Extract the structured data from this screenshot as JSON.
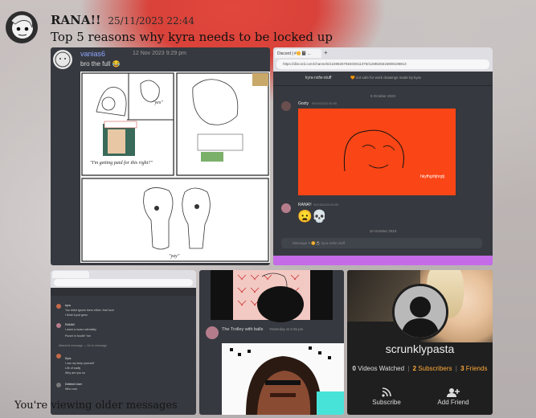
{
  "message": {
    "username": "RANA!!",
    "timestamp": "25/11/2023 22:44",
    "text": "Top 5 reasons why kyra needs to be locked up"
  },
  "attachments": {
    "drawing": {
      "author": "vanias6",
      "time": "12 Nov 2023 9:29 pm",
      "text": "bro the full",
      "captions": [
        "\"yes\"",
        "\"I'm getting paid for this right?\"",
        "\"yay\""
      ]
    },
    "discord_orange": {
      "tab_title": "Discord | #🌼📓 ...",
      "url": "https://discord.com/channels/1169826758403011376/1169825515808198813",
      "channel": "kyra-nsfw-stuff",
      "topic": "🧡 not safe for work drawings made by kyra",
      "date_top": "9 October 2023",
      "msg1_author": "Gozty",
      "msg1_time": "09/10/2023 00:00",
      "image_label": "hkyfhgrhjhrgtj",
      "msg2_author": "RANA!!",
      "msg2_time": "09/10/2023 00:00",
      "date_bottom": "10 October 2023",
      "chat_placeholder": "Message # 🌼📓 kyra-nsfw-stuff"
    },
    "discord_thread": {
      "lines": [
        "kyra",
        "You didnt ignore them either. that food",
        "I think it just grew",
        "RANA!!",
        "I want a moan rotentially",
        "Punch in booth! \"we",
        "Attached message — Go to message",
        "Kyra",
        "I can my keep yourself",
        "Life of sadly",
        "Why are you so",
        "Deleted User",
        "Who now"
      ]
    },
    "trolley": {
      "name": "The Trolley with balls",
      "time": "Yesterday at 3:45 pm"
    },
    "profile": {
      "username": "scrunklypasta",
      "videos_watched_count": "0",
      "videos_watched_label": "Videos Watched",
      "subscribers_count": "2",
      "subscribers_label": "Subscribers",
      "friends_count": "3",
      "friends_label": "Friends",
      "subscribe_label": "Subscribe",
      "add_friend_label": "Add Friend"
    }
  },
  "footer": {
    "older_messages": "You're viewing older messages"
  }
}
